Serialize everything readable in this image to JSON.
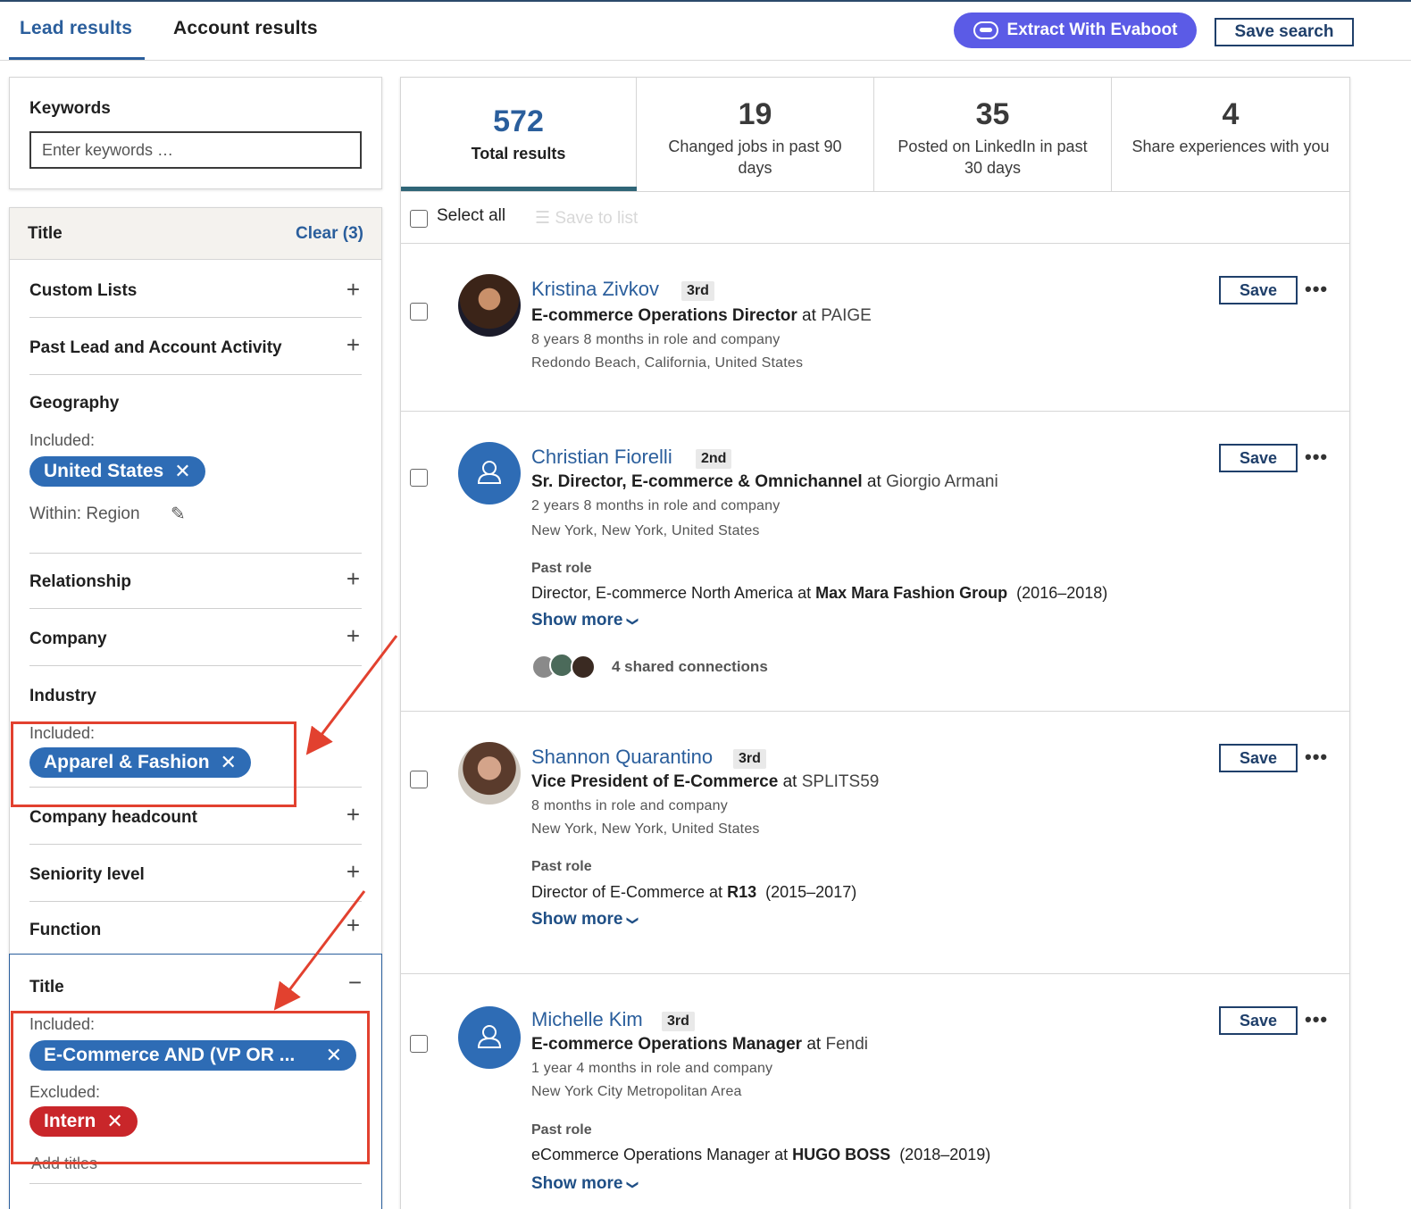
{
  "tabs": {
    "lead": "Lead results",
    "account": "Account results"
  },
  "top_actions": {
    "evaboot": "Extract With Evaboot",
    "save_search": "Save search"
  },
  "keywords": {
    "label": "Keywords",
    "placeholder": "Enter keywords …"
  },
  "filters": {
    "title": "Title",
    "clear": "Clear (3)",
    "custom_lists": "Custom Lists",
    "past_activity": "Past Lead and Account Activity",
    "geography": "Geography",
    "geo_included_label": "Included:",
    "geo_pill": "United States",
    "geo_within": "Within: Region",
    "relationship": "Relationship",
    "company": "Company",
    "industry": "Industry",
    "industry_included_label": "Included:",
    "industry_pill": "Apparel & Fashion",
    "headcount": "Company headcount",
    "seniority": "Seniority level",
    "function": "Function",
    "title_included_label": "Included:",
    "title_pill": "E-Commerce AND (VP OR ...",
    "title_excluded_label": "Excluded:",
    "title_excluded_pill": "Intern",
    "add_titles": "Add titles",
    "plus": "+",
    "minus": "−",
    "remove": "✕"
  },
  "stats": [
    {
      "num": "572",
      "label": "Total results"
    },
    {
      "num": "19",
      "label": "Changed jobs in past 90 days"
    },
    {
      "num": "35",
      "label": "Posted on LinkedIn in past 30 days"
    },
    {
      "num": "4",
      "label": "Share experiences with you"
    }
  ],
  "selectbar": {
    "select_all": "Select all",
    "save_to_list": "Save to list"
  },
  "leads": [
    {
      "name": "Kristina Zivkov",
      "degree": "3rd",
      "title": "E-commerce Operations Director",
      "at": "at",
      "company": "PAIGE",
      "tenure": "8 years 8 months in role and company",
      "location": "Redondo Beach, California, United States"
    },
    {
      "name": "Christian Fiorelli",
      "degree": "2nd",
      "title": "Sr. Director, E-commerce & Omnichannel",
      "at": "at",
      "company": "Giorgio Armani",
      "tenure": "2 years 8 months in role and company",
      "location": "New York, New York, United States",
      "past_label": "Past role",
      "past_title": "Director, E-commerce North America at",
      "past_company": "Max Mara Fashion Group",
      "past_years": "(2016–2018)",
      "show_more": "Show more",
      "shared": "4 shared connections"
    },
    {
      "name": "Shannon Quarantino",
      "degree": "3rd",
      "title": "Vice President of E-Commerce",
      "at": "at",
      "company": "SPLITS59",
      "tenure": "8 months in role and company",
      "location": "New York, New York, United States",
      "past_label": "Past role",
      "past_title": "Director of E-Commerce at",
      "past_company": "R13",
      "past_years": "(2015–2017)",
      "show_more": "Show more"
    },
    {
      "name": "Michelle Kim",
      "degree": "3rd",
      "title": "E-commerce Operations Manager",
      "at": "at",
      "company": "Fendi",
      "tenure": "1 year 4 months in role and company",
      "location": "New York City Metropolitan Area",
      "past_label": "Past role",
      "past_title": "eCommerce Operations Manager at",
      "past_company": "HUGO BOSS",
      "past_years": "(2018–2019)",
      "show_more": "Show more"
    }
  ],
  "lead_actions": {
    "save": "Save",
    "more": "•••"
  },
  "colors": {
    "link_blue": "#2a5e9c",
    "pill_blue": "#2e6cb5",
    "pill_red": "#c9262a",
    "evaboot": "#5b5be6",
    "annotation_red": "#e2412f"
  },
  "icons": {
    "pencil": "✎",
    "chevron": "❯"
  }
}
